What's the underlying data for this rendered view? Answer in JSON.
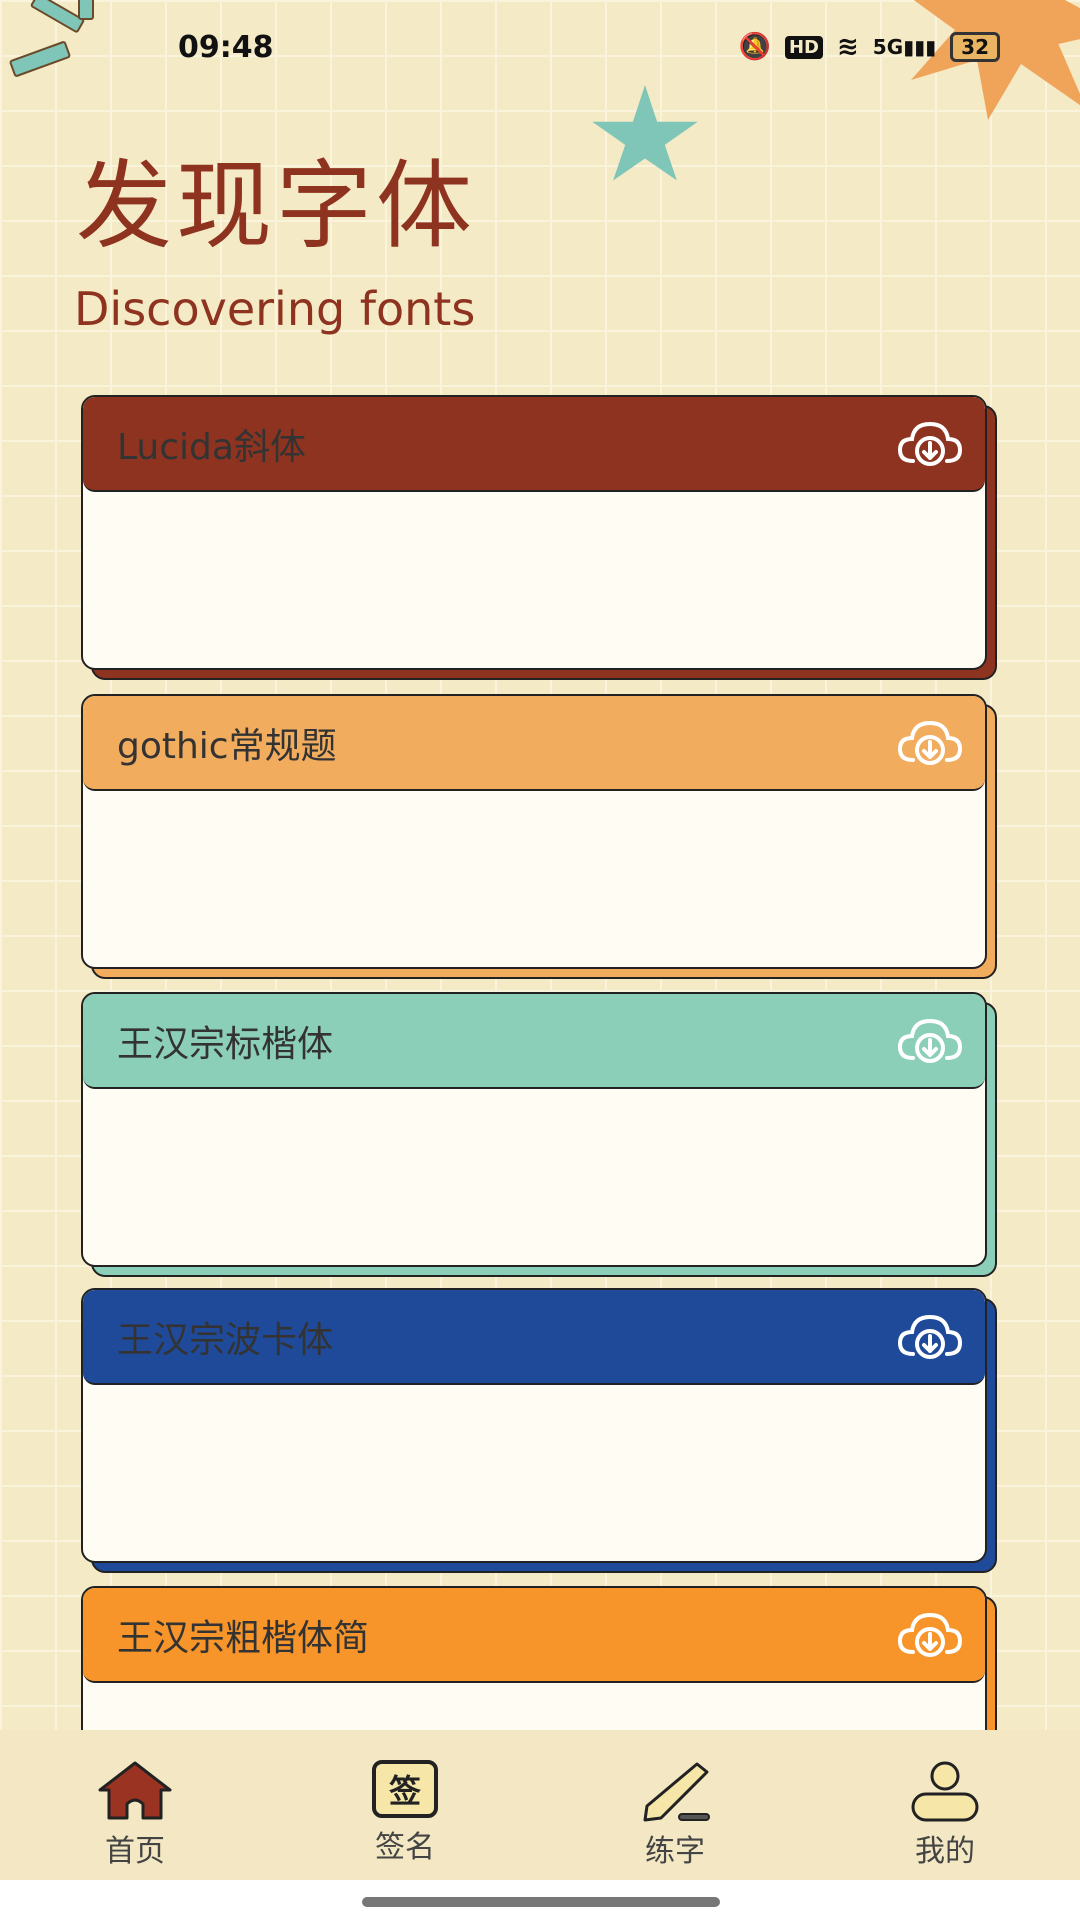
{
  "status": {
    "time": "09:48",
    "battery": "32",
    "hd": "HD",
    "network": "5G"
  },
  "header": {
    "title": "发现字体",
    "subtitle": "Discovering fonts"
  },
  "fonts": [
    {
      "name": "Lucida斜体",
      "color": "#8e3320",
      "icon": "cloud-download-icon"
    },
    {
      "name": "gothic常规题",
      "color": "#f2ac5e",
      "icon": "cloud-download-icon"
    },
    {
      "name": "王汉宗标楷体",
      "color": "#8ccfb8",
      "icon": "cloud-download-icon"
    },
    {
      "name": "王汉宗波卡体",
      "color": "#1f4a9a",
      "icon": "cloud-download-icon"
    },
    {
      "name": "王汉宗粗楷体简",
      "color": "#f7952a",
      "icon": "cloud-download-icon"
    }
  ],
  "nav": [
    {
      "label": "首页",
      "icon": "home-icon",
      "active": true
    },
    {
      "label": "签名",
      "icon": "signature-icon",
      "glyph": "签"
    },
    {
      "label": "练字",
      "icon": "pencil-icon"
    },
    {
      "label": "我的",
      "icon": "user-icon"
    }
  ],
  "colors": {
    "background": "#f4eac6",
    "accent": "#8e3320"
  }
}
